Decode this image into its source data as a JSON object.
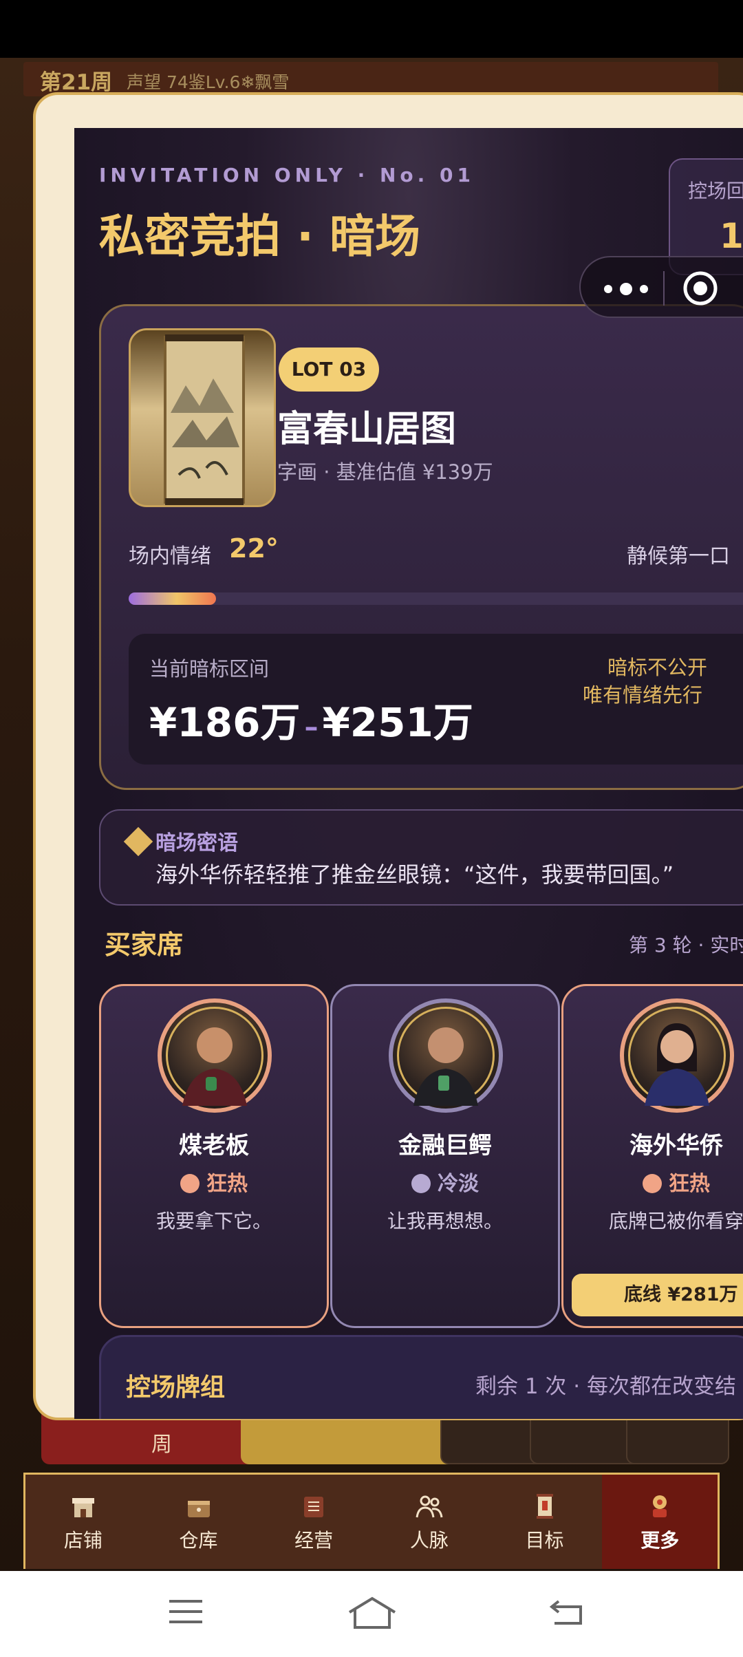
{
  "game": {
    "week": "第21周",
    "meta": "声望 74鉴Lv.6❄飘雪",
    "behind_tab_label": "周"
  },
  "bottom_nav": [
    {
      "label": "店铺",
      "icon": "shop-icon"
    },
    {
      "label": "仓库",
      "icon": "warehouse-icon"
    },
    {
      "label": "经营",
      "icon": "ledger-icon"
    },
    {
      "label": "人脉",
      "icon": "people-icon"
    },
    {
      "label": "目标",
      "icon": "scroll-icon"
    },
    {
      "label": "更多",
      "icon": "more-icon",
      "active": true
    }
  ],
  "modal": {
    "eyebrow": "INVITATION ONLY · No. 01",
    "title": "私密竞拍 · 暗场",
    "control_badge_label": "控场回",
    "control_badge_value": "1",
    "lot": {
      "tag": "LOT 03",
      "name": "富春山居图",
      "subtitle": "字画 · 基准估值 ¥139万",
      "mood_label": "场内情绪",
      "mood_value": "22°",
      "mood_percent": 22,
      "mood_status": "静候第一口",
      "bid_label": "当前暗标区间",
      "bid_low": "¥186万",
      "bid_dash": "–",
      "bid_high": "¥251万",
      "bid_note_1": "暗标不公开",
      "bid_note_2": "唯有情绪先行"
    },
    "whisper": {
      "label": "暗场密语",
      "text": "海外华侨轻轻推了推金丝眼镜：“这件，我要带回国。”"
    },
    "buyers_title": "买家席",
    "round_info": "第 3 轮 · 实时",
    "buyers": [
      {
        "name": "煤老板",
        "mood": "狂热",
        "quote": "我要拿下它。",
        "tone": "hot"
      },
      {
        "name": "金融巨鳄",
        "mood": "冷淡",
        "quote": "让我再想想。",
        "tone": "cold"
      },
      {
        "name": "海外华侨",
        "mood": "狂热",
        "quote": "底牌已被你看穿",
        "tone": "hot",
        "floor": "底线 ¥281万"
      }
    ],
    "deck": {
      "title": "控场牌组",
      "info": "剩余 1 次 · 每次都在改变结"
    }
  },
  "colors": {
    "accent_gold": "#f3c96b",
    "hot": "#f1a486",
    "cold": "#b7aad2",
    "panel": "#241a2c"
  }
}
